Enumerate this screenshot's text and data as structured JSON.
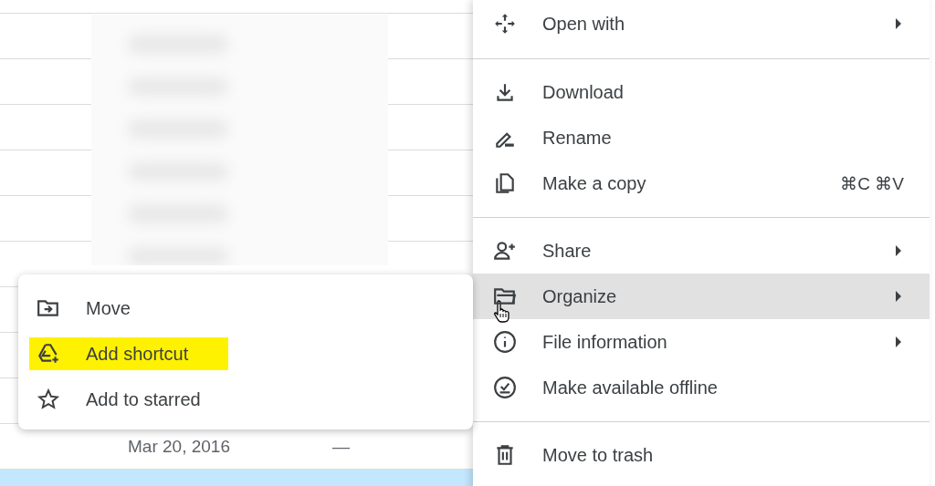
{
  "file_list": {
    "rows": [
      {
        "selected": false
      },
      {
        "selected": false
      },
      {
        "selected": false
      },
      {
        "selected": false
      },
      {
        "selected": false
      },
      {
        "selected": false
      },
      {
        "selected": false
      },
      {
        "selected": false
      },
      {
        "selected": false
      },
      {
        "selected": false,
        "modified": "Mar 20, 2016",
        "size": "—"
      },
      {
        "selected": true
      }
    ]
  },
  "context_menu": {
    "items": [
      {
        "kind": "item",
        "label": "Open with",
        "submenu": true,
        "selected": false
      },
      {
        "kind": "separator"
      },
      {
        "kind": "item",
        "label": "Download",
        "submenu": false,
        "selected": false
      },
      {
        "kind": "item",
        "label": "Rename",
        "submenu": false,
        "selected": false
      },
      {
        "kind": "item",
        "label": "Make a copy",
        "shortcut": "⌘C ⌘V",
        "submenu": false,
        "selected": false
      },
      {
        "kind": "separator"
      },
      {
        "kind": "item",
        "label": "Share",
        "submenu": true,
        "selected": false
      },
      {
        "kind": "item",
        "label": "Organize",
        "submenu": true,
        "selected": true
      },
      {
        "kind": "item",
        "label": "File information",
        "submenu": true,
        "selected": false
      },
      {
        "kind": "item",
        "label": "Make available offline",
        "submenu": false,
        "selected": false
      },
      {
        "kind": "separator"
      },
      {
        "kind": "item",
        "label": "Move to trash",
        "submenu": false,
        "selected": false
      }
    ]
  },
  "submenu": {
    "items": [
      {
        "label": "Move",
        "highlighted": false
      },
      {
        "label": "Add shortcut",
        "highlighted": true
      },
      {
        "label": "Add to starred",
        "highlighted": false
      }
    ]
  }
}
